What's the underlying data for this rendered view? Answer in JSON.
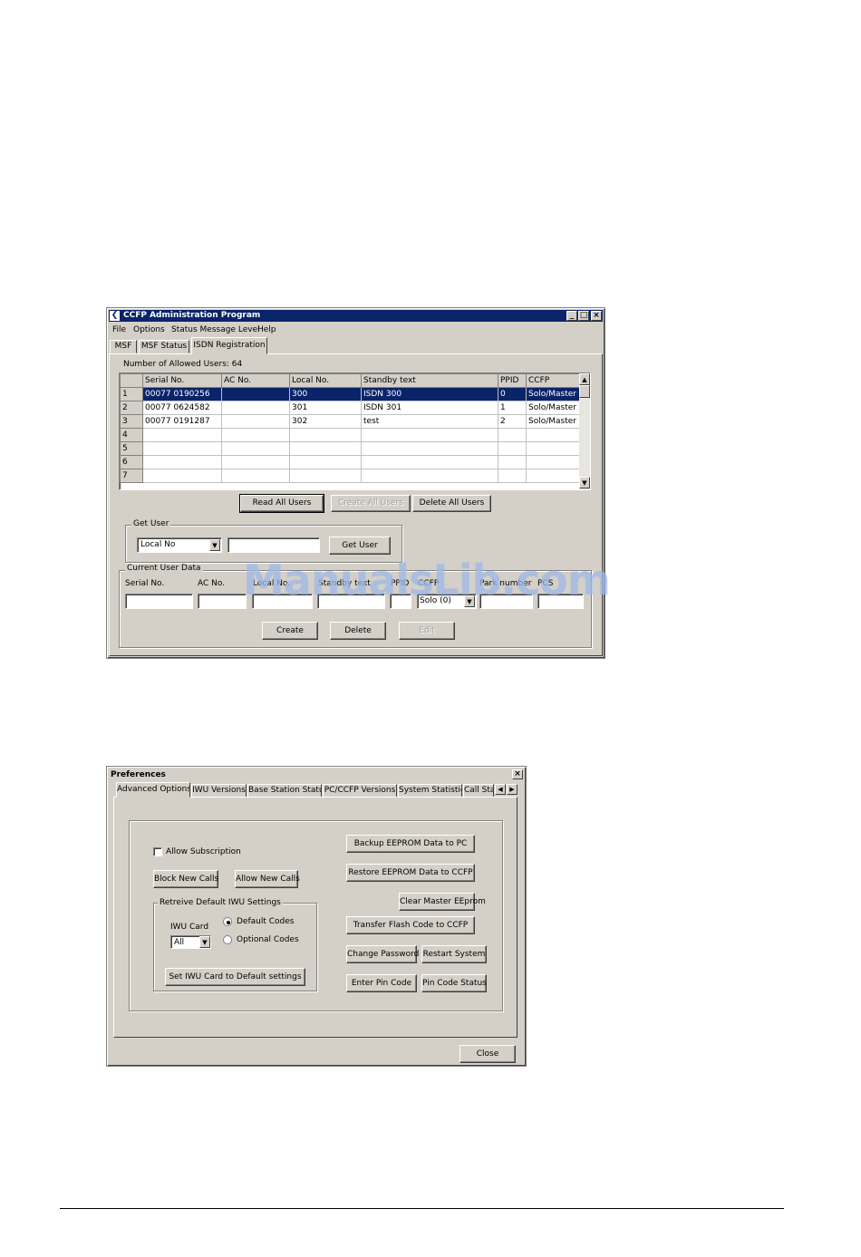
{
  "ccfp": {
    "title": "CCFP Administration Program",
    "menu": [
      "File",
      "Options",
      "Status Message Level",
      "Help"
    ],
    "tabs": [
      "MSF",
      "MSF Status",
      "ISDN Registration"
    ],
    "allowed_users": "Number of Allowed Users:  64",
    "columns": [
      "Serial No.",
      "AC No.",
      "Local No.",
      "Standby text",
      "PPID",
      "CCFP"
    ],
    "rows": [
      {
        "n": "1",
        "serial": "00077 0190256",
        "ac": "",
        "local": "300",
        "standby": "ISDN 300",
        "ppid": "0",
        "ccfp": "Solo/Master"
      },
      {
        "n": "2",
        "serial": "00077 0624582",
        "ac": "",
        "local": "301",
        "standby": "ISDN 301",
        "ppid": "1",
        "ccfp": "Solo/Master"
      },
      {
        "n": "3",
        "serial": "00077 0191287",
        "ac": "",
        "local": "302",
        "standby": "test",
        "ppid": "2",
        "ccfp": "Solo/Master"
      },
      {
        "n": "4",
        "serial": "",
        "ac": "",
        "local": "",
        "standby": "",
        "ppid": "",
        "ccfp": ""
      },
      {
        "n": "5",
        "serial": "",
        "ac": "",
        "local": "",
        "standby": "",
        "ppid": "",
        "ccfp": ""
      },
      {
        "n": "6",
        "serial": "",
        "ac": "",
        "local": "",
        "standby": "",
        "ppid": "",
        "ccfp": ""
      },
      {
        "n": "7",
        "serial": "",
        "ac": "",
        "local": "",
        "standby": "",
        "ppid": "",
        "ccfp": ""
      }
    ],
    "buttons": {
      "read_all": "Read All Users",
      "create_all": "Create All Users",
      "delete_all": "Delete All Users"
    },
    "get_user": {
      "group": "Get User",
      "select": "Local No",
      "value": "",
      "button": "Get User"
    },
    "current": {
      "group": "Current User Data",
      "labels": [
        "Serial No.",
        "AC No.",
        "Local No.",
        "Standby text",
        "PPID",
        "CCFP",
        "Park number",
        "PCS"
      ],
      "ccfp_select": "Solo (0)",
      "create": "Create",
      "delete": "Delete",
      "edit": "Edit"
    }
  },
  "watermark": "ManualsLib.com",
  "prefs": {
    "title": "Preferences",
    "tabs": [
      "Advanced Options",
      "IWU Versions",
      "Base Station Status",
      "PC/CCFP Versions",
      "System Statistics",
      "Call Sta"
    ],
    "allow_subscription": "Allow Subscription",
    "block_calls": "Block New Calls",
    "allow_calls": "Allow New Calls",
    "iwu_group": "Retreive Default IWU Settings",
    "iwu_card_label": "IWU Card",
    "iwu_card_value": "All",
    "default_codes": "Default Codes",
    "optional_codes": "Optional Codes",
    "set_default": "Set IWU Card to Default settings",
    "backup": "Backup EEPROM Data to PC",
    "restore": "Restore EEPROM Data to CCFP",
    "clear_master": "Clear Master EEprom",
    "transfer": "Transfer Flash Code to CCFP",
    "change_password": "Change Password",
    "restart": "Restart System",
    "enter_pin": "Enter Pin Code",
    "pin_status": "Pin Code Status",
    "close": "Close"
  },
  "colors": {
    "face": "#d4d0c8",
    "title_active": "#0a246a",
    "selection": "#0a246a",
    "watermark": "#9fb8e8"
  }
}
